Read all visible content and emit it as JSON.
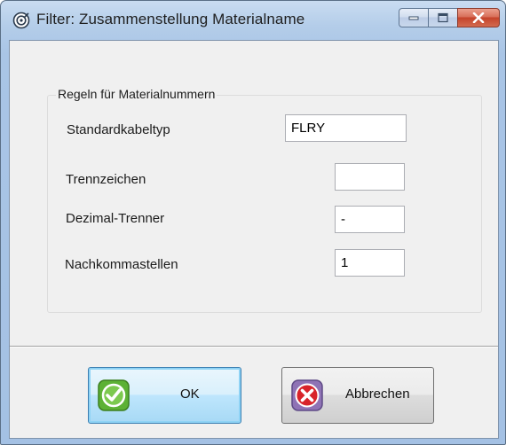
{
  "window": {
    "title": "Filter: Zusammenstellung Materialname",
    "icon": "target-icon",
    "controls": [
      "minimize-icon",
      "maximize-icon",
      "close-icon"
    ]
  },
  "group": {
    "title": "Regeln für Materialnummern"
  },
  "fields": [
    {
      "label": "Standardkabeltyp",
      "value": "FLRY"
    },
    {
      "label": "Trennzeichen",
      "value": ""
    },
    {
      "label": "Dezimal-Trenner",
      "value": "-"
    },
    {
      "label": "Nachkommastellen",
      "value": "1"
    }
  ],
  "buttons": {
    "ok": {
      "label": "OK",
      "icon": "checkmark-icon"
    },
    "cancel": {
      "label": "Abbrechen",
      "icon": "x-circle-icon"
    }
  },
  "colors": {
    "ok_icon": "#5cb135",
    "cancel_icon": "#d8232a",
    "close_button": "#c5432a"
  }
}
